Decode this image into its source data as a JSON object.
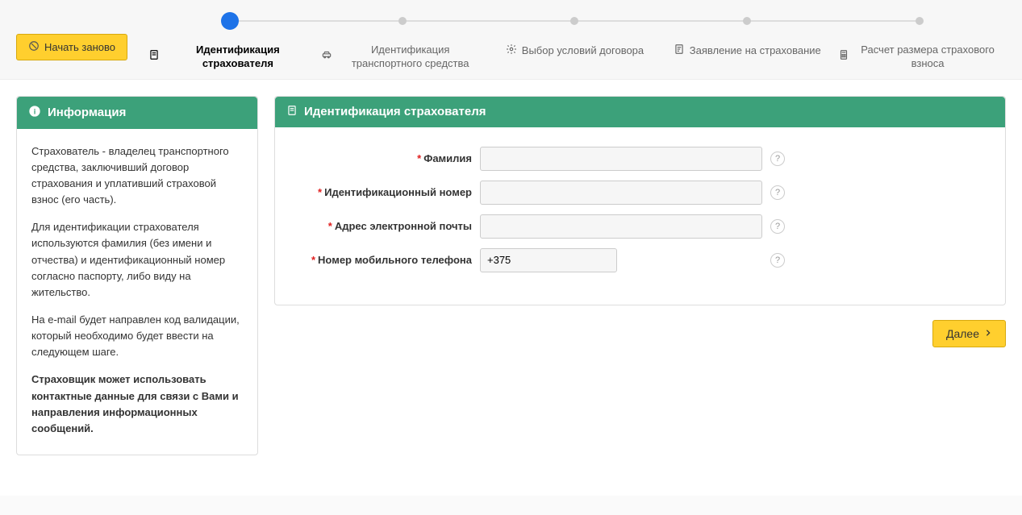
{
  "restart_label": "Начать заново",
  "steps": [
    {
      "label": "Идентификация страхователя",
      "active": true
    },
    {
      "label": "Идентификация транспортного средства",
      "active": false
    },
    {
      "label": "Выбор условий договора",
      "active": false
    },
    {
      "label": "Заявление на страхование",
      "active": false
    },
    {
      "label": "Расчет размера страхового взноса",
      "active": false
    }
  ],
  "info": {
    "title": "Информация",
    "p1": "Страхователь - владелец транспортного средства, заключивший договор страхования и уплативший страховой взнос (его часть).",
    "p2": "Для идентификации страхователя используются фамилия (без имени и отчества) и идентификационный номер согласно паспорту, либо виду на жительство.",
    "p3": "На e-mail будет направлен код валидации, который необходимо будет ввести на следующем шаге.",
    "p4": "Страховщик может использовать контактные данные для связи с Вами и направления информационных сообщений."
  },
  "form": {
    "title": "Идентификация страхователя",
    "fields": {
      "surname": {
        "label": "Фамилия",
        "value": ""
      },
      "id_number": {
        "label": "Идентификационный номер",
        "value": ""
      },
      "email": {
        "label": "Адрес электронной почты",
        "value": ""
      },
      "phone": {
        "label": "Номер мобильного телефона",
        "value": "+375"
      }
    }
  },
  "next_label": "Далее"
}
